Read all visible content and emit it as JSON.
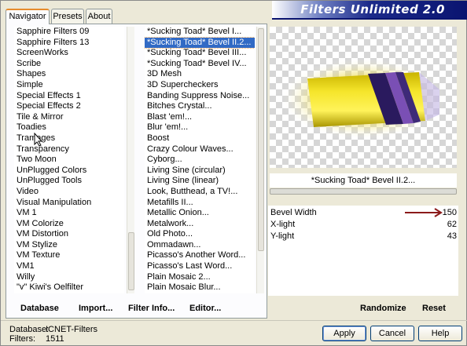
{
  "banner": {
    "title": "Filters Unlimited 2.0"
  },
  "tabs": [
    {
      "label": "Navigator",
      "active": true
    },
    {
      "label": "Presets",
      "active": false
    },
    {
      "label": "About",
      "active": false
    }
  ],
  "categories": {
    "items": [
      "Sapphire Filters 09",
      "Sapphire Filters 13",
      "ScreenWorks",
      "Scribe",
      "Shapes",
      "Simple",
      "Special Effects 1",
      "Special Effects 2",
      "Tile & Mirror",
      "Toadies",
      "Tramages",
      "Transparency",
      "Two Moon",
      "UnPlugged Colors",
      "UnPlugged Tools",
      "Video",
      "Visual Manipulation",
      "VM 1",
      "VM Colorize",
      "VM Distortion",
      "VM Stylize",
      "VM Texture",
      "VM1",
      "Willy",
      "\"v\" Kiwi's Oelfilter"
    ]
  },
  "filters": {
    "selected_index": 1,
    "items": [
      "*Sucking Toad*  Bevel I...",
      "*Sucking Toad*  Bevel II.2...",
      "*Sucking Toad*  Bevel III...",
      "*Sucking Toad*  Bevel IV...",
      "3D Mesh",
      "3D Supercheckers",
      "Banding Suppress Noise...",
      "Bitches Crystal...",
      "Blast 'em!...",
      "Blur 'em!...",
      "Boost",
      "Crazy Colour Waves...",
      "Cyborg...",
      "Living Sine (circular)",
      "Living Sine (linear)",
      "Look, Butthead, a TV!...",
      "Metafills II...",
      "Metallic Onion...",
      "Metalwork...",
      "Old Photo...",
      "Ommadawn...",
      "Picasso's Another Word...",
      "Picasso's Last Word...",
      "Plain Mosaic 2...",
      "Plain Mosaic Blur..."
    ]
  },
  "bottom_links": {
    "database": "Database",
    "import": "Import...",
    "filter_info": "Filter Info...",
    "editor": "Editor...",
    "randomize": "Randomize",
    "reset": "Reset"
  },
  "preview": {
    "filter_name": "*Sucking Toad*  Bevel II.2..."
  },
  "params": [
    {
      "label": "Bevel Width",
      "value": "150"
    },
    {
      "label": "X-light",
      "value": "62"
    },
    {
      "label": "Y-light",
      "value": "43"
    }
  ],
  "status": {
    "database_label": "Database:",
    "database_value": "ICNET-Filters",
    "filters_label": "Filters:",
    "filters_value": "1511"
  },
  "buttons": {
    "apply": "Apply",
    "cancel": "Cancel",
    "help": "Help"
  },
  "colors": {
    "selection": "#316ac5",
    "arrow": "#8b1a1a",
    "banner": "#0a1470"
  }
}
